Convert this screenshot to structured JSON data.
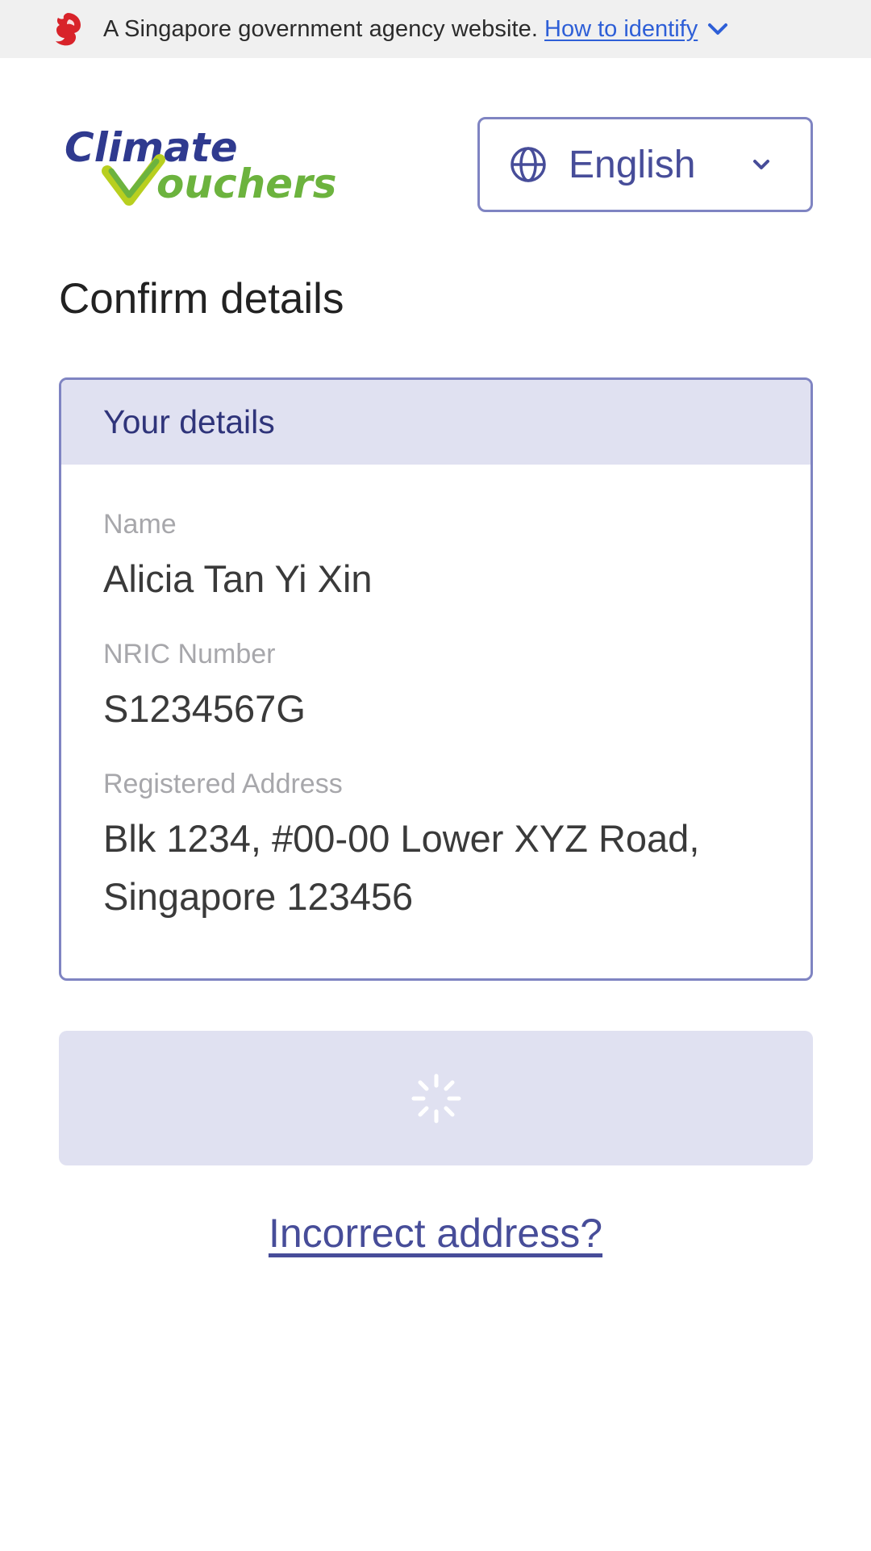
{
  "masthead": {
    "text": "A Singapore government agency website.",
    "link": "How to identify"
  },
  "header": {
    "logo_top": "Climate",
    "logo_bottom": "ouchers",
    "logo_v": "V",
    "language": "English"
  },
  "page": {
    "title": "Confirm details"
  },
  "card": {
    "heading": "Your details",
    "fields": [
      {
        "label": "Name",
        "value": "Alicia Tan Yi Xin"
      },
      {
        "label": "NRIC Number",
        "value": "S1234567G"
      },
      {
        "label": "Registered Address",
        "value": "Blk 1234, #00-00 Lower XYZ Road, Singapore 123456"
      }
    ]
  },
  "actions": {
    "incorrect_address": "Incorrect address?"
  },
  "colors": {
    "accent": "#474d99",
    "card_border": "#7f84c2",
    "header_bg": "#e0e1f1",
    "masthead_bg": "#f0f0f0",
    "link_blue": "#2e5fd7",
    "lion_red": "#d8232a",
    "logo_blue": "#2f3a8f",
    "logo_green": "#6cb33e"
  }
}
